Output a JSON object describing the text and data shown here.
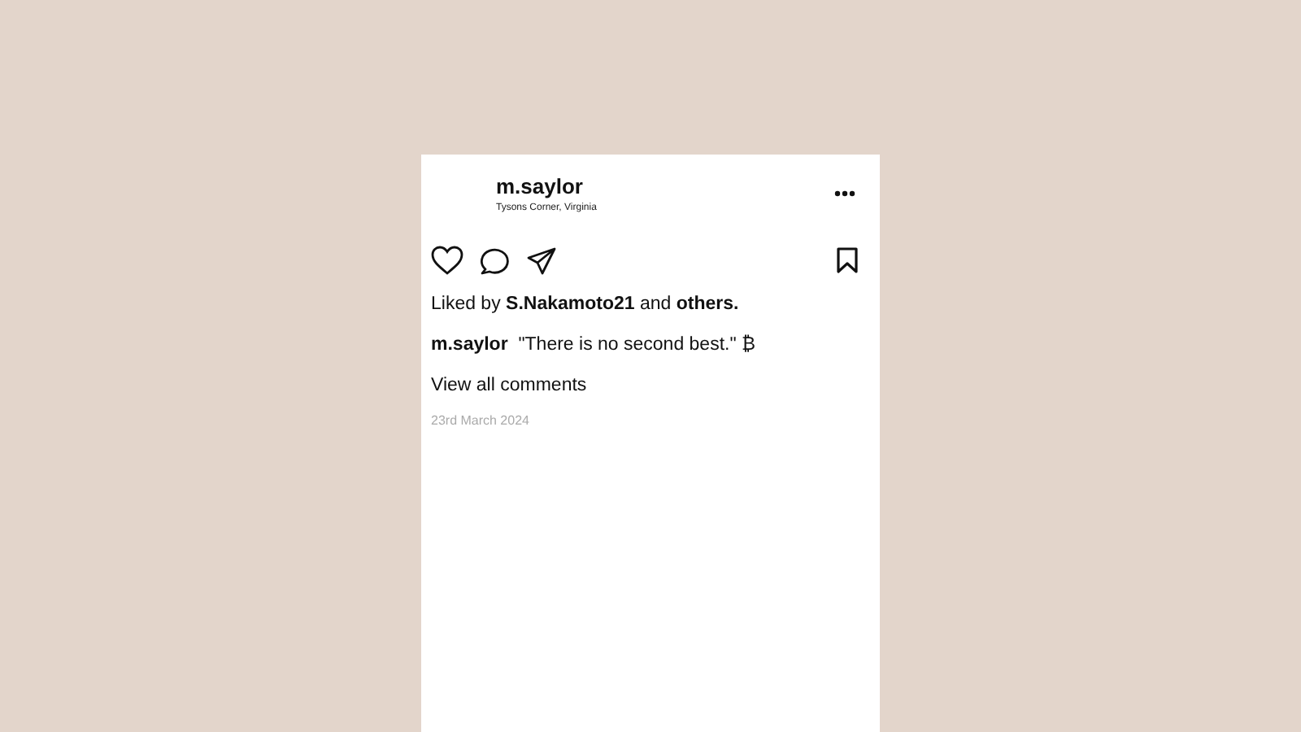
{
  "post": {
    "username": "m.saylor",
    "location": "Tysons Corner, Virginia",
    "likes": "Liked by **S.Nakamoto21** and **others.**",
    "caption": "**m.saylor**  \"There is no second best.\" ₿",
    "view_comments": "View all comments",
    "date": "23rd March 2024"
  }
}
